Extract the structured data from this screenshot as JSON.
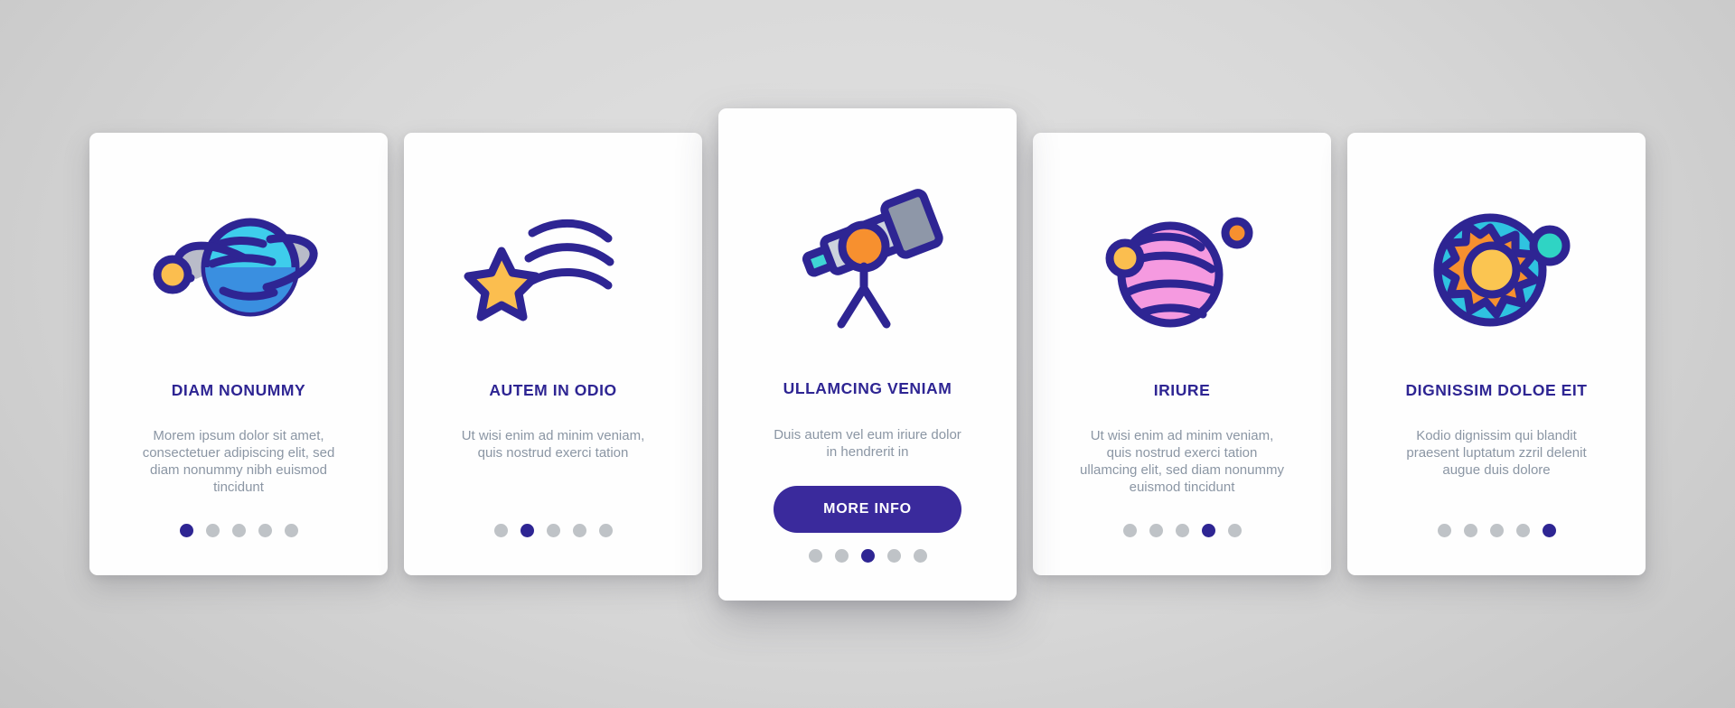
{
  "theme": {
    "accent": "#2e2593",
    "button_bg": "#3a2a9c",
    "body_text": "#8b96a4",
    "dot_inactive": "#bfc3c7",
    "dot_active": "#2e2593",
    "card_bg": "#fefefe",
    "background": "#d4d4d4"
  },
  "cards": [
    {
      "icon_name": "ringed-planet-icon",
      "title": "DIAM NONUMMY",
      "description": "Morem ipsum dolor sit amet, consectetuer adipiscing elit, sed diam nonummy nibh euismod tincidunt",
      "dots_total": 5,
      "dot_active_index": 0,
      "featured": false,
      "has_button": false
    },
    {
      "icon_name": "shooting-star-icon",
      "title": "AUTEM IN ODIO",
      "description": "Ut wisi enim ad minim veniam, quis nostrud exerci tation",
      "dots_total": 5,
      "dot_active_index": 1,
      "featured": false,
      "has_button": false
    },
    {
      "icon_name": "telescope-icon",
      "title": "ULLAMCING VENIAM",
      "description": "Duis autem vel eum iriure dolor in hendrerit in",
      "button_label": "MORE INFO",
      "dots_total": 5,
      "dot_active_index": 2,
      "featured": true,
      "has_button": true
    },
    {
      "icon_name": "striped-planet-icon",
      "title": "IRIURE",
      "description": "Ut wisi enim ad minim veniam, quis nostrud exerci tation ullamcing elit, sed diam nonummy euismod tincidunt",
      "dots_total": 5,
      "dot_active_index": 3,
      "featured": false,
      "has_button": false
    },
    {
      "icon_name": "sun-planet-icon",
      "title": "DIGNISSIM DOLOE EIT",
      "description": "Kodio dignissim qui blandit praesent luptatum zzril delenit augue duis dolore",
      "dots_total": 5,
      "dot_active_index": 4,
      "featured": false,
      "has_button": false
    }
  ]
}
